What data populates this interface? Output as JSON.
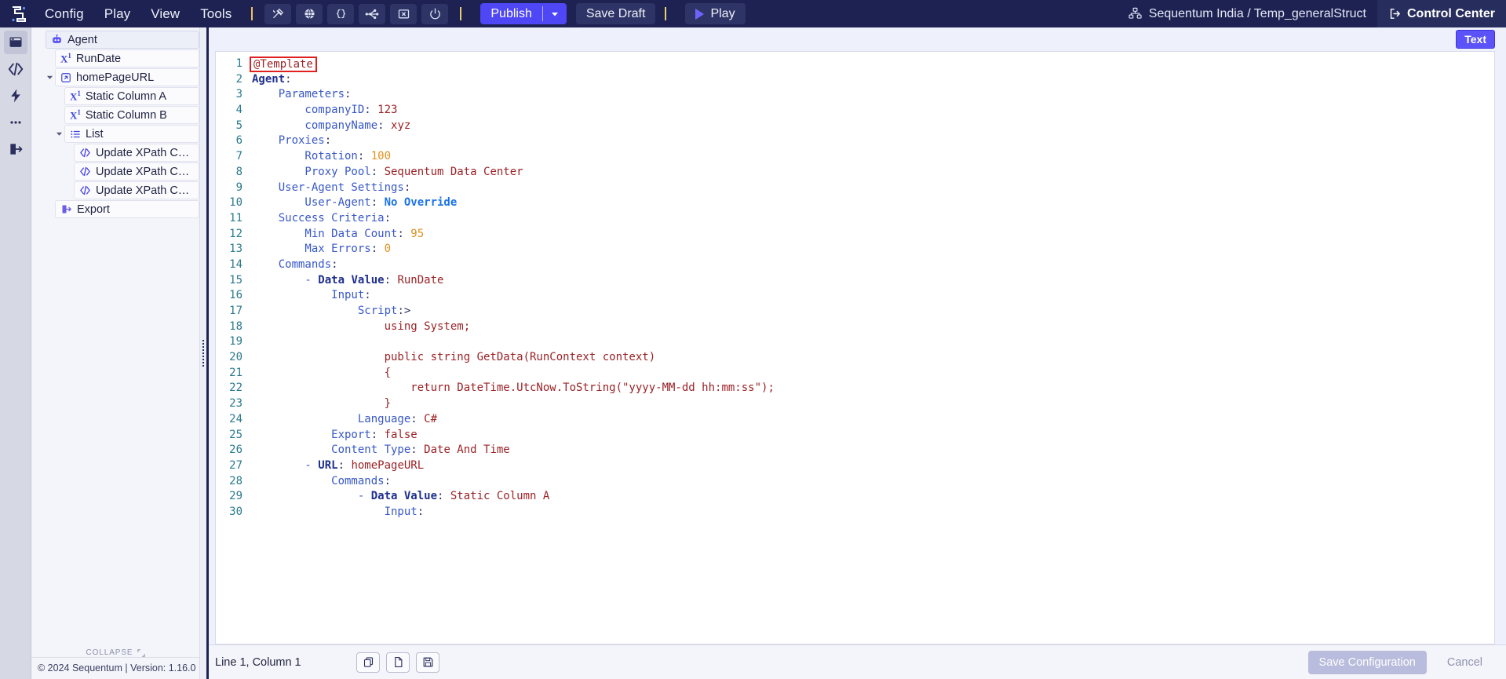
{
  "topbar": {
    "logo_icon": "sequentum-logo-icon",
    "menus": [
      {
        "label": "Config"
      },
      {
        "label": "Play"
      },
      {
        "label": "View"
      },
      {
        "label": "Tools"
      }
    ],
    "tool_icons": [
      {
        "name": "tools-wrench-icon",
        "title": "Tools"
      },
      {
        "name": "globe-icon",
        "title": "Browser"
      },
      {
        "name": "braces-icon",
        "title": "Json"
      },
      {
        "name": "network-nodes-icon",
        "title": "Graph"
      },
      {
        "name": "close-file-icon",
        "title": "Close"
      },
      {
        "name": "power-icon",
        "title": "Power"
      }
    ],
    "publish_label": "Publish",
    "publish_caret_icon": "chevron-down-icon",
    "save_draft_label": "Save Draft",
    "play_label": "Play",
    "play_icon": "play-triangle-icon",
    "org_icon": "org-hierarchy-icon",
    "org_label": "Sequentum India / Temp_generalStruct",
    "control_center_label": "Control Center",
    "control_center_icon": "external-link-icon"
  },
  "rail": {
    "items": [
      {
        "name": "panel-layout-icon",
        "label": "Layout"
      },
      {
        "name": "code-brackets-icon",
        "label": "Code"
      },
      {
        "name": "lightning-bolt-icon",
        "label": "Actions"
      },
      {
        "name": "ellipsis-icon",
        "label": "More"
      },
      {
        "name": "export-arrow-icon",
        "label": "Export"
      }
    ]
  },
  "tree": {
    "items": [
      {
        "label": "Agent",
        "icon": "robot-icon",
        "indent": 0,
        "twisty": "",
        "selected": true
      },
      {
        "label": "RunDate",
        "icon": "superscript-x-icon",
        "indent": 1,
        "twisty": "",
        "selected": false
      },
      {
        "label": "homePageURL",
        "icon": "external-link-icon",
        "indent": 1,
        "twisty": "down",
        "selected": false
      },
      {
        "label": "Static Column A",
        "icon": "superscript-x-icon",
        "indent": 2,
        "twisty": "",
        "selected": false
      },
      {
        "label": "Static Column B",
        "icon": "superscript-x-icon",
        "indent": 2,
        "twisty": "",
        "selected": false
      },
      {
        "label": "List",
        "icon": "list-icon",
        "indent": 2,
        "twisty": "down",
        "selected": false
      },
      {
        "label": "Update XPath Column A",
        "icon": "code-brackets-icon",
        "indent": 3,
        "twisty": "",
        "selected": false
      },
      {
        "label": "Update XPath Column B",
        "icon": "code-brackets-icon",
        "indent": 3,
        "twisty": "",
        "selected": false
      },
      {
        "label": "Update XPath Column C",
        "icon": "code-brackets-icon",
        "indent": 3,
        "twisty": "",
        "selected": false
      },
      {
        "label": "Export",
        "icon": "export-arrow-icon",
        "indent": 1,
        "twisty": "",
        "selected": false
      }
    ],
    "collapse_label": "COLLAPSE",
    "collapse_icon": "collapse-brackets-icon"
  },
  "footer": {
    "copyright": "© 2024 Sequentum | Version: 1.16.0"
  },
  "editor": {
    "mode_badge": "Text",
    "highlight_line": 1,
    "lines": [
      {
        "n": 1,
        "tokens": [
          {
            "t": "@Template",
            "c": "k-plain",
            "boxed": true
          }
        ]
      },
      {
        "n": 2,
        "tokens": [
          {
            "t": "Agent",
            "c": "k-keyb"
          },
          {
            "t": ":",
            "c": "k-punc"
          }
        ]
      },
      {
        "n": 3,
        "tokens": [
          {
            "t": "    Parameters",
            "c": "k-key"
          },
          {
            "t": ":",
            "c": "k-punc"
          }
        ]
      },
      {
        "n": 4,
        "tokens": [
          {
            "t": "        companyID",
            "c": "k-key"
          },
          {
            "t": ": ",
            "c": "k-punc"
          },
          {
            "t": "123",
            "c": "k-str"
          }
        ]
      },
      {
        "n": 5,
        "tokens": [
          {
            "t": "        companyName",
            "c": "k-key"
          },
          {
            "t": ": ",
            "c": "k-punc"
          },
          {
            "t": "xyz",
            "c": "k-str"
          }
        ]
      },
      {
        "n": 6,
        "tokens": [
          {
            "t": "    Proxies",
            "c": "k-key"
          },
          {
            "t": ":",
            "c": "k-punc"
          }
        ]
      },
      {
        "n": 7,
        "tokens": [
          {
            "t": "        Rotation",
            "c": "k-key"
          },
          {
            "t": ": ",
            "c": "k-punc"
          },
          {
            "t": "100",
            "c": "k-num"
          }
        ]
      },
      {
        "n": 8,
        "tokens": [
          {
            "t": "        Proxy Pool",
            "c": "k-key"
          },
          {
            "t": ": ",
            "c": "k-punc"
          },
          {
            "t": "Sequentum Data Center",
            "c": "k-str"
          }
        ]
      },
      {
        "n": 9,
        "tokens": [
          {
            "t": "    User-Agent Settings",
            "c": "k-key"
          },
          {
            "t": ":",
            "c": "k-punc"
          }
        ]
      },
      {
        "n": 10,
        "tokens": [
          {
            "t": "        User-Agent",
            "c": "k-key"
          },
          {
            "t": ": ",
            "c": "k-punc"
          },
          {
            "t": "No Override",
            "c": "k-bool"
          }
        ]
      },
      {
        "n": 11,
        "tokens": [
          {
            "t": "    Success Criteria",
            "c": "k-key"
          },
          {
            "t": ":",
            "c": "k-punc"
          }
        ]
      },
      {
        "n": 12,
        "tokens": [
          {
            "t": "        Min Data Count",
            "c": "k-key"
          },
          {
            "t": ": ",
            "c": "k-punc"
          },
          {
            "t": "95",
            "c": "k-num"
          }
        ]
      },
      {
        "n": 13,
        "tokens": [
          {
            "t": "        Max Errors",
            "c": "k-key"
          },
          {
            "t": ": ",
            "c": "k-punc"
          },
          {
            "t": "0",
            "c": "k-num"
          }
        ]
      },
      {
        "n": 14,
        "tokens": [
          {
            "t": "    Commands",
            "c": "k-key"
          },
          {
            "t": ":",
            "c": "k-punc"
          }
        ]
      },
      {
        "n": 15,
        "tokens": [
          {
            "t": "        - ",
            "c": "k-dash"
          },
          {
            "t": "Data Value",
            "c": "k-keyb"
          },
          {
            "t": ": ",
            "c": "k-punc"
          },
          {
            "t": "RunDate",
            "c": "k-str"
          }
        ]
      },
      {
        "n": 16,
        "tokens": [
          {
            "t": "            Input",
            "c": "k-key"
          },
          {
            "t": ":",
            "c": "k-punc"
          }
        ]
      },
      {
        "n": 17,
        "tokens": [
          {
            "t": "                Script",
            "c": "k-key"
          },
          {
            "t": ":>",
            "c": "k-punc"
          }
        ]
      },
      {
        "n": 18,
        "tokens": [
          {
            "t": "                    using System;",
            "c": "k-str"
          }
        ]
      },
      {
        "n": 19,
        "tokens": [
          {
            "t": "",
            "c": "k-str"
          }
        ]
      },
      {
        "n": 20,
        "tokens": [
          {
            "t": "                    public string GetData(RunContext context)",
            "c": "k-str"
          }
        ]
      },
      {
        "n": 21,
        "tokens": [
          {
            "t": "                    {",
            "c": "k-str"
          }
        ]
      },
      {
        "n": 22,
        "tokens": [
          {
            "t": "                        return DateTime.UtcNow.ToString(\"yyyy-MM-dd hh:mm:ss\");",
            "c": "k-str"
          }
        ]
      },
      {
        "n": 23,
        "tokens": [
          {
            "t": "                    }",
            "c": "k-str"
          }
        ]
      },
      {
        "n": 24,
        "tokens": [
          {
            "t": "                Language",
            "c": "k-key"
          },
          {
            "t": ": ",
            "c": "k-punc"
          },
          {
            "t": "C#",
            "c": "k-str"
          }
        ]
      },
      {
        "n": 25,
        "tokens": [
          {
            "t": "            Export",
            "c": "k-key"
          },
          {
            "t": ": ",
            "c": "k-punc"
          },
          {
            "t": "false",
            "c": "k-str"
          }
        ]
      },
      {
        "n": 26,
        "tokens": [
          {
            "t": "            Content Type",
            "c": "k-key"
          },
          {
            "t": ": ",
            "c": "k-punc"
          },
          {
            "t": "Date And Time",
            "c": "k-str"
          }
        ]
      },
      {
        "n": 27,
        "tokens": [
          {
            "t": "        - ",
            "c": "k-dash"
          },
          {
            "t": "URL",
            "c": "k-keyb"
          },
          {
            "t": ": ",
            "c": "k-punc"
          },
          {
            "t": "homePageURL",
            "c": "k-str"
          }
        ]
      },
      {
        "n": 28,
        "tokens": [
          {
            "t": "            Commands",
            "c": "k-key"
          },
          {
            "t": ":",
            "c": "k-punc"
          }
        ]
      },
      {
        "n": 29,
        "tokens": [
          {
            "t": "                - ",
            "c": "k-dash"
          },
          {
            "t": "Data Value",
            "c": "k-keyb"
          },
          {
            "t": ": ",
            "c": "k-punc"
          },
          {
            "t": "Static Column A",
            "c": "k-str"
          }
        ]
      },
      {
        "n": 30,
        "tokens": [
          {
            "t": "                    Input",
            "c": "k-key"
          },
          {
            "t": ":",
            "c": "k-punc"
          }
        ]
      }
    ]
  },
  "statusbar": {
    "position_text": "Line 1, Column 1",
    "buttons": [
      {
        "name": "copy-icon",
        "label": "Copy"
      },
      {
        "name": "new-file-icon",
        "label": "New"
      },
      {
        "name": "save-disk-icon",
        "label": "Save"
      }
    ],
    "save_configuration_label": "Save Configuration",
    "cancel_label": "Cancel"
  }
}
